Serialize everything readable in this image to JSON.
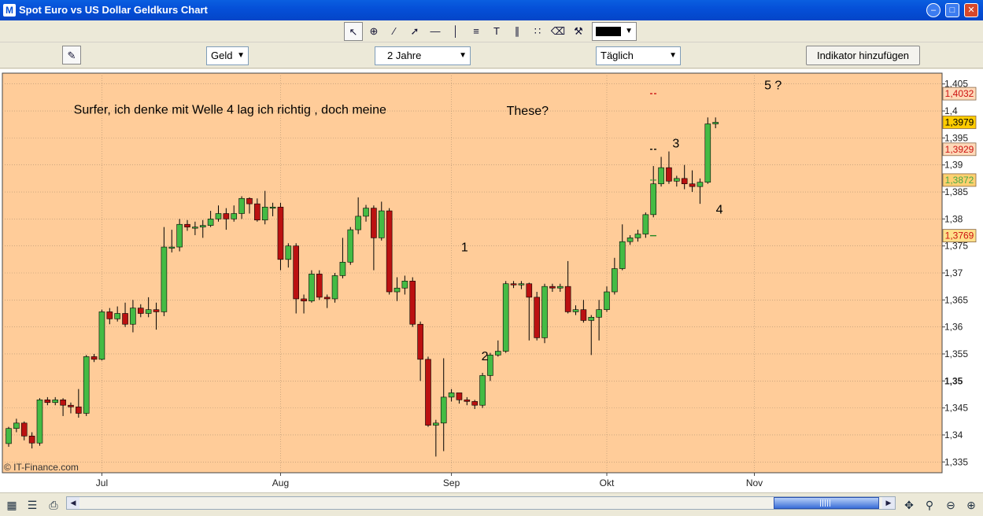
{
  "window": {
    "title": "Spot Euro vs US Dollar Geldkurs Chart",
    "app_icon": "M",
    "controls": [
      "minimize-icon",
      "maximize-icon",
      "close-icon"
    ]
  },
  "toolbar": {
    "tools": [
      "pointer-icon",
      "zoom-crosshair-icon",
      "line-icon",
      "trendline-icon",
      "horizontal-line-icon",
      "vertical-line-icon",
      "fibonacci-icon",
      "text-icon",
      "parallel-lines-icon",
      "points-icon",
      "trash-icon",
      "tools-icon"
    ],
    "selected_tool": "pointer-icon",
    "line_color": "#000000"
  },
  "controls": {
    "price_type": "Geld",
    "period": "2 Jahre",
    "interval": "Täglich",
    "add_indicator_label": "Indikator hinzufügen"
  },
  "chart_data": {
    "type": "candlestick",
    "instrument": "Spot Euro vs US Dollar Geldkurs",
    "y_axis": {
      "range": [
        1.333,
        1.407
      ],
      "ticks": [
        "1,405",
        "1,4",
        "1,395",
        "1,39",
        "1,385",
        "1,38",
        "1,375",
        "1,37",
        "1,365",
        "1,36",
        "1,355",
        "1,35",
        "1,345",
        "1,34",
        "1,335"
      ],
      "bold_tick": "1,35"
    },
    "x_axis": {
      "labels": [
        {
          "label": "Jul",
          "index": 12
        },
        {
          "label": "Aug",
          "index": 35
        },
        {
          "label": "Sep",
          "index": 57
        },
        {
          "label": "Okt",
          "index": 77
        },
        {
          "label": "Nov",
          "index": 96
        }
      ]
    },
    "candles": [
      [
        1.3384,
        1.3412,
        1.3378,
        1.3415
      ],
      [
        1.3412,
        1.3422,
        1.3405,
        1.343
      ],
      [
        1.3422,
        1.3398,
        1.339,
        1.3425
      ],
      [
        1.3398,
        1.3385,
        1.3375,
        1.3405
      ],
      [
        1.3385,
        1.3465,
        1.338,
        1.3468
      ],
      [
        1.3465,
        1.346,
        1.3455,
        1.347
      ],
      [
        1.346,
        1.3465,
        1.3455,
        1.347
      ],
      [
        1.3465,
        1.3455,
        1.3435,
        1.3468
      ],
      [
        1.3455,
        1.3452,
        1.344,
        1.346
      ],
      [
        1.3452,
        1.344,
        1.3432,
        1.3485
      ],
      [
        1.344,
        1.3545,
        1.3435,
        1.3548
      ],
      [
        1.3545,
        1.354,
        1.3535,
        1.355
      ],
      [
        1.354,
        1.3628,
        1.3538,
        1.3632
      ],
      [
        1.3628,
        1.3615,
        1.3605,
        1.3635
      ],
      [
        1.3615,
        1.3625,
        1.361,
        1.3638
      ],
      [
        1.3625,
        1.3605,
        1.36,
        1.3645
      ],
      [
        1.3605,
        1.3635,
        1.359,
        1.365
      ],
      [
        1.3635,
        1.3625,
        1.3618,
        1.3642
      ],
      [
        1.3625,
        1.3632,
        1.3618,
        1.3655
      ],
      [
        1.3632,
        1.3628,
        1.3595,
        1.3645
      ],
      [
        1.3628,
        1.3748,
        1.362,
        1.3785
      ],
      [
        1.3748,
        1.3748,
        1.3738,
        1.378
      ],
      [
        1.3748,
        1.379,
        1.374,
        1.38
      ],
      [
        1.379,
        1.3785,
        1.3778,
        1.3798
      ],
      [
        1.3785,
        1.3785,
        1.377,
        1.3795
      ],
      [
        1.3785,
        1.3788,
        1.3765,
        1.3798
      ],
      [
        1.3788,
        1.38,
        1.3785,
        1.3815
      ],
      [
        1.38,
        1.381,
        1.3795,
        1.3825
      ],
      [
        1.381,
        1.38,
        1.378,
        1.382
      ],
      [
        1.38,
        1.381,
        1.3795,
        1.3825
      ],
      [
        1.381,
        1.3838,
        1.38,
        1.3842
      ],
      [
        1.3838,
        1.3828,
        1.381,
        1.384
      ],
      [
        1.3828,
        1.3798,
        1.3795,
        1.3838
      ],
      [
        1.3798,
        1.3822,
        1.379,
        1.3852
      ],
      [
        1.3822,
        1.3822,
        1.3805,
        1.383
      ],
      [
        1.3822,
        1.3725,
        1.3705,
        1.383
      ],
      [
        1.3725,
        1.375,
        1.371,
        1.3755
      ],
      [
        1.375,
        1.3652,
        1.3625,
        1.3755
      ],
      [
        1.3652,
        1.3648,
        1.3625,
        1.366
      ],
      [
        1.3648,
        1.3698,
        1.3645,
        1.3705
      ],
      [
        1.3698,
        1.3655,
        1.365,
        1.3705
      ],
      [
        1.3655,
        1.3652,
        1.3635,
        1.366
      ],
      [
        1.3652,
        1.3695,
        1.3645,
        1.37
      ],
      [
        1.3695,
        1.372,
        1.369,
        1.3765
      ],
      [
        1.372,
        1.378,
        1.3715,
        1.3785
      ],
      [
        1.378,
        1.3805,
        1.3772,
        1.384
      ],
      [
        1.3805,
        1.382,
        1.3795,
        1.3826
      ],
      [
        1.382,
        1.3765,
        1.3705,
        1.3825
      ],
      [
        1.3765,
        1.3815,
        1.376,
        1.3832
      ],
      [
        1.3815,
        1.3665,
        1.366,
        1.382
      ],
      [
        1.3665,
        1.3672,
        1.3648,
        1.3692
      ],
      [
        1.3672,
        1.3685,
        1.366,
        1.3695
      ],
      [
        1.3685,
        1.3605,
        1.36,
        1.3692
      ],
      [
        1.3605,
        1.354,
        1.35,
        1.361
      ],
      [
        1.354,
        1.3418,
        1.3415,
        1.3545
      ],
      [
        1.3418,
        1.3422,
        1.336,
        1.3428
      ],
      [
        1.3422,
        1.347,
        1.337,
        1.3542
      ],
      [
        1.347,
        1.3478,
        1.3462,
        1.3485
      ],
      [
        1.3478,
        1.3465,
        1.3458,
        1.3472
      ],
      [
        1.3465,
        1.3462,
        1.3455,
        1.347
      ],
      [
        1.3462,
        1.3455,
        1.3448,
        1.3465
      ],
      [
        1.3455,
        1.351,
        1.345,
        1.3515
      ],
      [
        1.351,
        1.3548,
        1.35,
        1.3552
      ],
      [
        1.3548,
        1.3555,
        1.3545,
        1.3575
      ],
      [
        1.3555,
        1.368,
        1.3552,
        1.3685
      ],
      [
        1.368,
        1.3678,
        1.3672,
        1.3685
      ],
      [
        1.3678,
        1.368,
        1.367,
        1.3685
      ],
      [
        1.368,
        1.3655,
        1.3575,
        1.3682
      ],
      [
        1.3655,
        1.358,
        1.3575,
        1.3665
      ],
      [
        1.358,
        1.3675,
        1.357,
        1.368
      ],
      [
        1.3675,
        1.3672,
        1.3665,
        1.368
      ],
      [
        1.3672,
        1.3675,
        1.3665,
        1.368
      ],
      [
        1.3675,
        1.3628,
        1.3625,
        1.3722
      ],
      [
        1.3628,
        1.3632,
        1.3622,
        1.364
      ],
      [
        1.3632,
        1.3612,
        1.3608,
        1.365
      ],
      [
        1.3612,
        1.3618,
        1.3548,
        1.3622
      ],
      [
        1.3618,
        1.3632,
        1.3575,
        1.365
      ],
      [
        1.3632,
        1.3665,
        1.3628,
        1.3675
      ],
      [
        1.3665,
        1.3708,
        1.366,
        1.3728
      ],
      [
        1.3708,
        1.3758,
        1.3705,
        1.379
      ],
      [
        1.3758,
        1.3765,
        1.3752,
        1.377
      ],
      [
        1.3765,
        1.3772,
        1.3758,
        1.378
      ],
      [
        1.3772,
        1.3808,
        1.3765,
        1.3812
      ],
      [
        1.3808,
        1.3865,
        1.3803,
        1.3898
      ],
      [
        1.3865,
        1.3895,
        1.386,
        1.3915
      ],
      [
        1.3895,
        1.387,
        1.3865,
        1.3925
      ],
      [
        1.387,
        1.3875,
        1.386,
        1.388
      ],
      [
        1.3875,
        1.3865,
        1.3855,
        1.39
      ],
      [
        1.3865,
        1.386,
        1.385,
        1.389
      ],
      [
        1.386,
        1.3868,
        1.3828,
        1.3875
      ],
      [
        1.3868,
        1.3976,
        1.3865,
        1.3988
      ],
      [
        1.3976,
        1.3979,
        1.3968,
        1.3988
      ]
    ],
    "price_levels": [
      {
        "label": "1,4032",
        "value": 1.4032,
        "color": "#cc1111",
        "box_color": "#ffd9b8",
        "text_color": "#cc1111"
      },
      {
        "label": "1,3979",
        "value": 1.3979,
        "color": "#000000",
        "box_color": "#ffcc00",
        "text_color": "#000000"
      },
      {
        "label": "1,3929",
        "value": 1.3929,
        "color": "#000000",
        "box_color": "#ffd9b8",
        "text_color": "#cc1111"
      },
      {
        "label": "1,3872",
        "value": 1.3872,
        "color": "#44aa44",
        "box_color": "#ffd070",
        "text_color": "#44aa44"
      },
      {
        "label": "1,3769",
        "value": 1.3769,
        "color": "#228822",
        "box_color": "#ffe08a",
        "text_color": "#cc1111"
      }
    ],
    "annotations": [
      {
        "text": "Surfer, ich denke mit Welle 4 lag ich richtig , doch meine",
        "index": 28.5,
        "y": 1.3995
      },
      {
        "text": "These?",
        "index": 66.8,
        "y": 1.3993
      },
      {
        "text": "1",
        "index": 58.7,
        "y": 1.374
      },
      {
        "text": "2",
        "index": 61.3,
        "y": 1.3538
      },
      {
        "text": "3",
        "index": 85.9,
        "y": 1.3932
      },
      {
        "text": "4",
        "index": 91.5,
        "y": 1.381
      },
      {
        "text": "5 ?",
        "index": 98.4,
        "y": 1.404
      }
    ],
    "watermark": "© IT-Finance.com",
    "colors": {
      "background": "#ffcc99",
      "up": "#44bb44",
      "down": "#bb1111",
      "grid": "#b09070"
    },
    "grid": true
  },
  "statusbar": {
    "icons": [
      "chart-settings-icon",
      "chart-type-icon",
      "print-icon",
      "scroll-left-icon",
      "scroll-right-icon",
      "pan-icon",
      "zoom-box-icon",
      "zoom-out-icon",
      "zoom-in-icon"
    ]
  }
}
